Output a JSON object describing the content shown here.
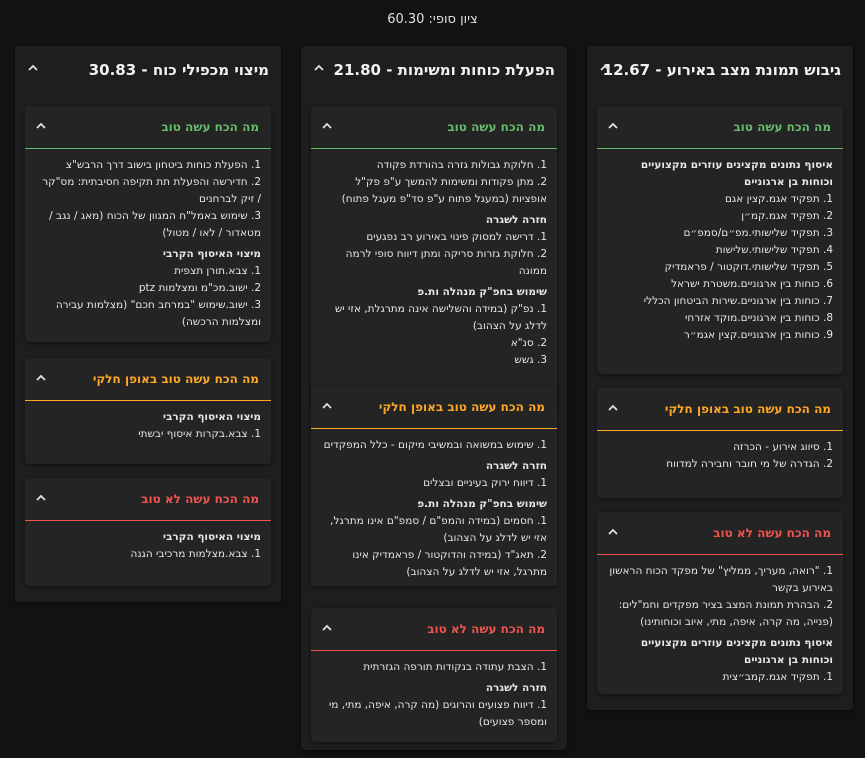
{
  "final_score": "ציון סופי: 60.30",
  "colors": {
    "good": "#66bb6a",
    "partial": "#ffa726",
    "bad": "#ef5350"
  },
  "columns": [
    {
      "title": "גיבוש תמונת מצב באירוע - 12.67",
      "cards": [
        {
          "title": "מה הכח עשה טוב",
          "sections": [
            {
              "heading": "איסוף נתונים מקצינים עוזרים מקצועיים וכוחות בן ארגוניים",
              "items": [
                "1. תפקיד אגמ.קצין אגם",
                "2. תפקיד אגמ.קמ״ן",
                "3. תפקיד שלישותי.מפ״ם/סמפ״ם",
                "4. תפקיד שלישותי.שלישות",
                "5. תפקיד שלישותי.דוקטור / פראמדיק",
                "6. כוחות בין ארגוניים.משטרת ישראל",
                "7. כוחות בין ארגוניים.שירות הביטחון הכללי",
                "8. כוחות בין ארגוניים.מוקד אזרחי",
                "9. כוחות בין ארגוניים.קצין אגמ״ר"
              ]
            }
          ]
        },
        {
          "title": "מה הכח עשה טוב באופן חלקי",
          "sections": [
            {
              "heading": "",
              "items": [
                "1. סיווג אירוע - הכרזה",
                "2. הגדרה של מי חובר וחבירה למדווח"
              ]
            }
          ]
        },
        {
          "title": "מה הכח עשה לא טוב",
          "sections": [
            {
              "heading": "",
              "items": [
                "1. \"רואה, מעריך, ממליץ\" של מפקד הכוח הראשון באירוע בקשר",
                "2. הבהרת תמונת המצב בציר מפקדים וחמ\"לים: (פנייה, מה קרה, איפה, מתי, איוב וכוחותינו)"
              ]
            },
            {
              "heading": "איסוף נתונים מקצינים עוזרים מקצועיים וכוחות בן ארגוניים",
              "items": [
                "1. תפקיד אגמ.קמב״צית"
              ]
            }
          ]
        }
      ]
    },
    {
      "title": "הפעלת כוחות ומשימות - 21.80",
      "cards": [
        {
          "title": "מה הכח עשה טוב",
          "sections": [
            {
              "heading": "",
              "items": [
                "1. חלוקת גבולות גזרה בהורדת פקודה",
                "2. מתן פקודות ומשימות להמשך ע\"פ פק\"ל אופציות (במעגל פתוח ע\"פ סד\"פ מעגל פתוח)"
              ]
            },
            {
              "heading": "חזרה לשגרה",
              "items": [
                "1. דרישה למסוק פינוי באירוע רב נפגעים",
                "2. חלוקת גזרות סריקה ומתן דיווח סופי לרמה ממונה"
              ]
            },
            {
              "heading": "שימוש בחפ\"ק מנהלה ות.פ",
              "items": [
                "1. נפ\"ק (במידה והשלישה אינה מתרגלת, אזי יש לדלג על הצהוב)",
                "2. סנ\"א",
                "3. גשש"
              ]
            }
          ]
        },
        {
          "title": "מה הכח עשה טוב באופן חלקי",
          "sections": [
            {
              "heading": "",
              "items": [
                "1. שימוש במשואה ובמשיבי מיקום - כלל המפקדים"
              ]
            },
            {
              "heading": "חזרה לשגרה",
              "items": [
                "1. דיווח ירוק בעיניים ובצלים"
              ]
            },
            {
              "heading": "שימוש בחפ\"ק מנהלה ות.פ",
              "items": [
                "1. חסמים (במידה והמפ\"ם / סמפ\"ם אינו מתרגל, אזי יש לדלג על הצהוב)",
                "2. תאג\"ד (במידה והדוקטור / פראמדיק אינו מתרגל, אזי יש לדלג על הצהוב)"
              ]
            }
          ]
        },
        {
          "title": "מה הכח עשה לא טוב",
          "sections": [
            {
              "heading": "",
              "items": [
                "1. הצבת עתודה בנקודות תורפה הגזרתית"
              ]
            },
            {
              "heading": "חזרה לשגרה",
              "items": [
                "1. דיווח פצועים והרוגים (מה קרה, איפה, מתי, מי ומספר פצועים)"
              ]
            }
          ]
        }
      ]
    },
    {
      "title": "מיצוי מכפילי כוח - 30.83",
      "cards": [
        {
          "title": "מה הכח עשה טוב",
          "sections": [
            {
              "heading": "",
              "items": [
                "1. הפעלת כוחות ביטחון בישוב דרך הרבש\"צ",
                "2. חדירשה והפעלת תת תקיפה חסיבתית: מס\"קר / זיק לברחנים",
                "3. שימוש באמל\"ח המגוון של הכוח (מאג / נגב / מטאדור / לאו / מטול)"
              ]
            },
            {
              "heading": "מיצוי האיסוף הקרבי",
              "items": [
                "1. צבא.תורן תצפית",
                "2. ישוב.מכ\"מ ומצלמות ptz",
                "3. ישוב.שימוש \"במרחב חכם\" (מצלמות עבירה ומצלמות הרכשה)"
              ]
            }
          ]
        },
        {
          "title": "מה הכח עשה טוב באופן חלקי",
          "sections": [
            {
              "heading": "מיצוי האיסוף הקרבי",
              "items": [
                "1. צבא.בקרות איסוף יבשתי"
              ]
            }
          ]
        },
        {
          "title": "מה הכח עשה לא טוב",
          "sections": [
            {
              "heading": "מיצוי האיסוף הקרבי",
              "items": [
                "1. צבא.מצלמות מרכיבי הגנה"
              ]
            }
          ]
        }
      ]
    }
  ]
}
